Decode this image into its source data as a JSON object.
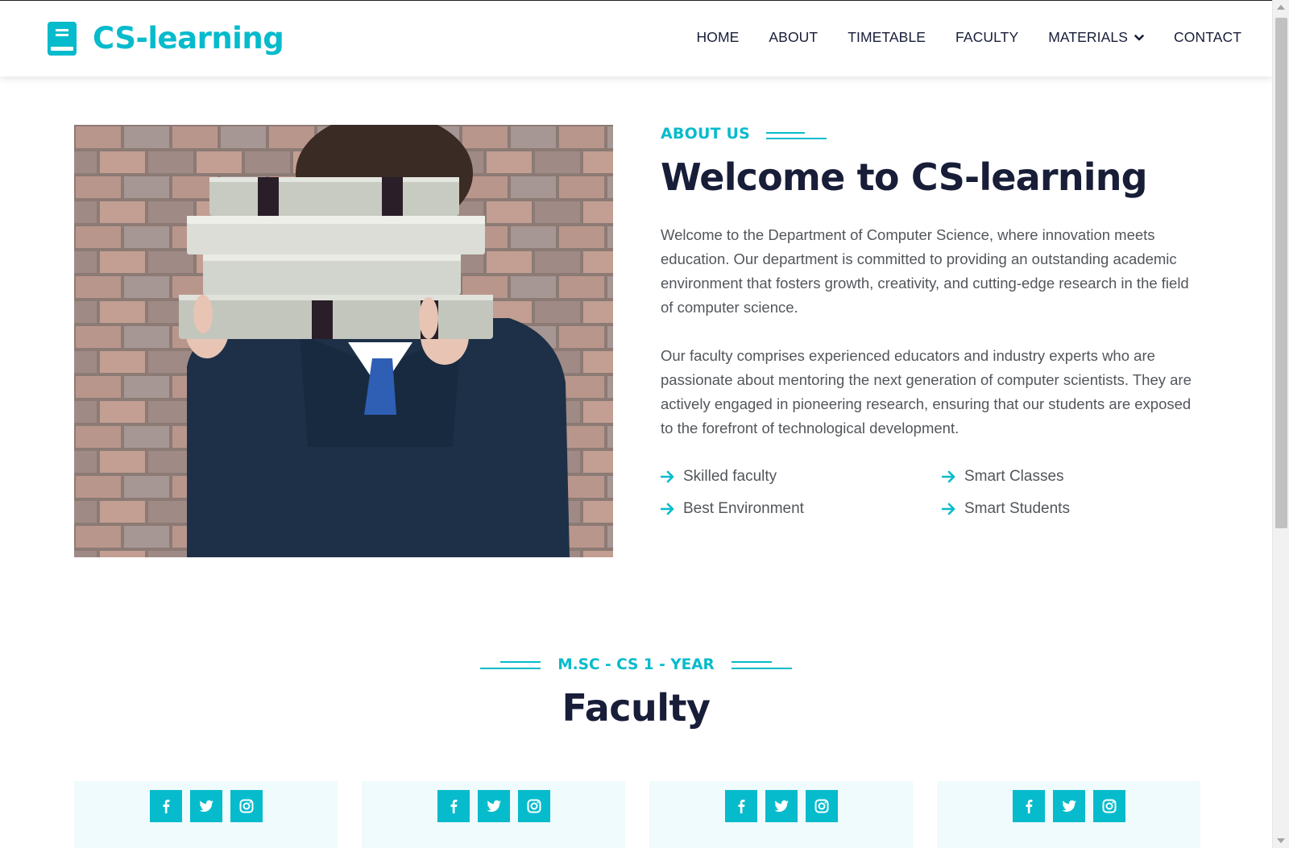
{
  "brand": {
    "name": "CS-learning",
    "icon": "book-icon",
    "color": "#06bbcc"
  },
  "nav": {
    "items": [
      {
        "label": "HOME"
      },
      {
        "label": "ABOUT"
      },
      {
        "label": "TIMETABLE"
      },
      {
        "label": "FACULTY"
      },
      {
        "label": "MATERIALS",
        "dropdown": true
      },
      {
        "label": "CONTACT"
      }
    ]
  },
  "about": {
    "label": "ABOUT US",
    "title": "Welcome to CS-learning",
    "paragraphs": [
      "Welcome to the Department of Computer Science, where innovation meets education. Our department is committed to providing an outstanding academic environment that fosters growth, creativity, and cutting-edge research in the field of computer science.",
      "Our faculty comprises experienced educators and industry experts who are passionate about mentoring the next generation of computer scientists. They are actively engaged in pioneering research, ensuring that our students are exposed to the forefront of technological development."
    ],
    "features": [
      "Skilled faculty",
      "Smart Classes",
      "Best Environment",
      "Smart Students"
    ]
  },
  "faculty": {
    "label": "M.SC - CS 1 - YEAR",
    "title": "Faculty",
    "cards": [
      {
        "socials": [
          "facebook-icon",
          "twitter-icon",
          "instagram-icon"
        ]
      },
      {
        "socials": [
          "facebook-icon",
          "twitter-icon",
          "instagram-icon"
        ]
      },
      {
        "socials": [
          "facebook-icon",
          "twitter-icon",
          "instagram-icon"
        ]
      },
      {
        "socials": [
          "facebook-icon",
          "twitter-icon",
          "instagram-icon"
        ]
      }
    ]
  },
  "colors": {
    "primary": "#06bbcc",
    "dark": "#181d38",
    "body_text": "#52565b",
    "card_bg": "#effbfc"
  }
}
